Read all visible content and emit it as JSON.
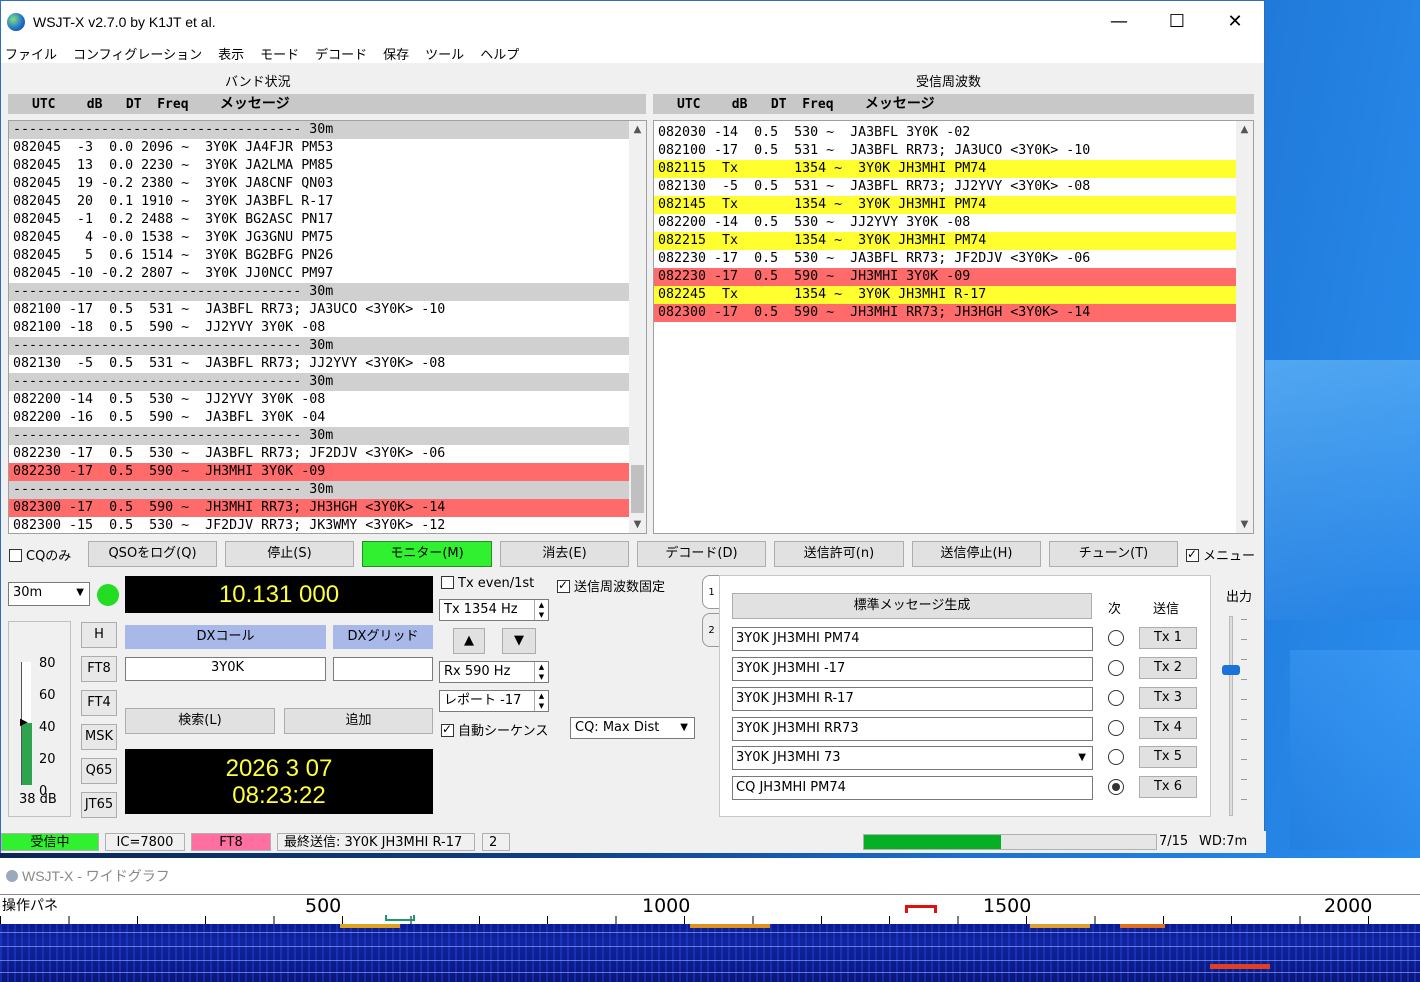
{
  "window": {
    "title": "WSJT-X   v2.7.0   by K1JT et al.",
    "controls": {
      "minimize": "—",
      "maximize": "☐",
      "close": "✕"
    }
  },
  "menu": [
    "ファイル",
    "コンフィグレーション",
    "表示",
    "モード",
    "デコード",
    "保存",
    "ツール",
    "ヘルプ"
  ],
  "band_activity": {
    "title": "バンド状況",
    "header": {
      "cols": "UTC    dB   DT  Freq",
      "msg": "メッセージ"
    },
    "rows": [
      {
        "t": "------------------------------------ 30m",
        "s": "sep"
      },
      {
        "t": "082045  -3  0.0 2096 ~  3Y0K JA4FJR PM53",
        "s": ""
      },
      {
        "t": "082045  13  0.0 2230 ~  3Y0K JA2LMA PM85",
        "s": ""
      },
      {
        "t": "082045  19 -0.2 2380 ~  3Y0K JA8CNF QN03",
        "s": ""
      },
      {
        "t": "082045  20  0.1 1910 ~  3Y0K JA3BFL R-17",
        "s": ""
      },
      {
        "t": "082045  -1  0.2 2488 ~  3Y0K BG2ASC PN17",
        "s": ""
      },
      {
        "t": "082045   4 -0.0 1538 ~  3Y0K JG3GNU PM75",
        "s": ""
      },
      {
        "t": "082045   5  0.6 1514 ~  3Y0K BG2BFG PN26",
        "s": ""
      },
      {
        "t": "082045 -10 -0.2 2807 ~  3Y0K JJ0NCC PM97",
        "s": ""
      },
      {
        "t": "------------------------------------ 30m",
        "s": "sep"
      },
      {
        "t": "082100 -17  0.5  531 ~  JA3BFL RR73; JA3UCO <3Y0K> -10",
        "s": ""
      },
      {
        "t": "082100 -18  0.5  590 ~  JJ2YVY 3Y0K -08",
        "s": ""
      },
      {
        "t": "------------------------------------ 30m",
        "s": "sep"
      },
      {
        "t": "082130  -5  0.5  531 ~  JA3BFL RR73; JJ2YVY <3Y0K> -08",
        "s": ""
      },
      {
        "t": "------------------------------------ 30m",
        "s": "sep"
      },
      {
        "t": "082200 -14  0.5  530 ~  JJ2YVY 3Y0K -08",
        "s": ""
      },
      {
        "t": "082200 -16  0.5  590 ~  JA3BFL 3Y0K -04",
        "s": ""
      },
      {
        "t": "------------------------------------ 30m",
        "s": "sep"
      },
      {
        "t": "082230 -17  0.5  530 ~  JA3BFL RR73; JF2DJV <3Y0K> -06",
        "s": ""
      },
      {
        "t": "082230 -17  0.5  590 ~  JH3MHI 3Y0K -09",
        "s": "red"
      },
      {
        "t": "------------------------------------ 30m",
        "s": "sep"
      },
      {
        "t": "082300 -17  0.5  590 ~  JH3MHI RR73; JH3HGH <3Y0K> -14",
        "s": "red"
      },
      {
        "t": "082300 -15  0.5  530 ~  JF2DJV RR73; JK3WMY <3Y0K> -12",
        "s": ""
      }
    ]
  },
  "rx_frequency": {
    "title": "受信周波数",
    "header": {
      "cols": "UTC    dB   DT  Freq",
      "msg": "メッセージ"
    },
    "rows": [
      {
        "t": "082030 -14  0.5  530 ~  JA3BFL 3Y0K -02",
        "s": ""
      },
      {
        "t": "082100 -17  0.5  531 ~  JA3BFL RR73; JA3UCO <3Y0K> -10",
        "s": ""
      },
      {
        "t": "082115  Tx       1354 ~  3Y0K JH3MHI PM74",
        "s": "tx"
      },
      {
        "t": "082130  -5  0.5  531 ~  JA3BFL RR73; JJ2YVY <3Y0K> -08",
        "s": ""
      },
      {
        "t": "082145  Tx       1354 ~  3Y0K JH3MHI PM74",
        "s": "tx"
      },
      {
        "t": "082200 -14  0.5  530 ~  JJ2YVY 3Y0K -08",
        "s": ""
      },
      {
        "t": "082215  Tx       1354 ~  3Y0K JH3MHI PM74",
        "s": "tx"
      },
      {
        "t": "082230 -17  0.5  530 ~  JA3BFL RR73; JF2DJV <3Y0K> -06",
        "s": ""
      },
      {
        "t": "082230 -17  0.5  590 ~  JH3MHI 3Y0K -09",
        "s": "red"
      },
      {
        "t": "082245  Tx       1354 ~  3Y0K JH3MHI R-17",
        "s": "tx"
      },
      {
        "t": "082300 -17  0.5  590 ~  JH3MHI RR73; JH3HGH <3Y0K> -14",
        "s": "red"
      }
    ]
  },
  "controls_row": {
    "cq_only": "CQのみ",
    "log_qso": "QSOをログ(Q)",
    "stop": "停止(S)",
    "monitor": "モニター(M)",
    "erase": "消去(E)",
    "decode": "デコード(D)",
    "enable_tx": "送信許可(n)",
    "halt_tx": "送信停止(H)",
    "tune": "チューン(T)",
    "menus": "メニュー"
  },
  "band_select": "30m",
  "dial_freq": "10.131 000",
  "level": {
    "scale": [
      "80",
      "60",
      "40",
      "20",
      "0"
    ],
    "db": "38 dB",
    "value": 40
  },
  "mode_buttons": [
    "H",
    "FT8",
    "FT4",
    "MSK",
    "Q65",
    "JT65"
  ],
  "dx": {
    "call_label": "DXコール",
    "grid_label": "DXグリッド",
    "call": "3Y0K",
    "grid": "",
    "lookup": "検索(L)",
    "add": "追加"
  },
  "datetime": {
    "date": "2026 3 07",
    "time": "08:23:22"
  },
  "tx_even": "Tx even/1st",
  "hold_tx_freq": "送信周波数固定",
  "tx_freq": "Tx  1354  Hz",
  "rx_freq": "Rx  590  Hz",
  "report": "レポート -17",
  "auto_seq": "自動シーケンス",
  "cq_select": "CQ: Max Dist",
  "tabs": [
    "1",
    "2"
  ],
  "messages": {
    "gen_std": "標準メッセージ生成",
    "next_label": "次",
    "tx_label": "送信",
    "rows": [
      {
        "msg": "3Y0K JH3MHI PM74",
        "btn": "Tx 1",
        "selected": false
      },
      {
        "msg": "3Y0K JH3MHI -17",
        "btn": "Tx 2",
        "selected": false
      },
      {
        "msg": "3Y0K JH3MHI R-17",
        "btn": "Tx 3",
        "selected": false
      },
      {
        "msg": "3Y0K JH3MHI RR73",
        "btn": "Tx 4",
        "selected": false
      },
      {
        "msg": "3Y0K JH3MHI 73",
        "btn": "Tx 5",
        "selected": false
      },
      {
        "msg": "CQ  JH3MHI PM74",
        "btn": "Tx 6",
        "selected": true
      }
    ]
  },
  "power_label": "出力",
  "status": {
    "receiving": "受信中",
    "ic": "IC=7800",
    "mode": "FT8",
    "last_tx": "最終送信: 3Y0K JH3MHI R-17",
    "count": "2",
    "progress": "7/15",
    "progress_value": 0.47,
    "wd": "WD:7m"
  },
  "wide_graph": {
    "title": "WSJT-X - ワイドグラフ",
    "panel_label": "操作パネ",
    "scale": [
      "500",
      "1000",
      "1500",
      "2000"
    ]
  },
  "colors": {
    "monitor": "#30f030",
    "tx_row": "#ffff30",
    "red_row": "#ff6a6a",
    "receiving": "#30f030",
    "mode": "#ff70a0",
    "dx_blue": "#a8b8e8"
  }
}
